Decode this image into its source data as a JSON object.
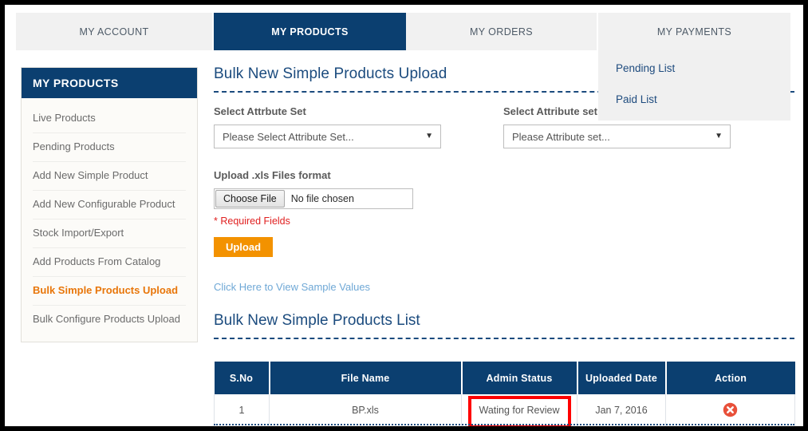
{
  "nav": {
    "tabs": [
      {
        "label": "MY ACCOUNT",
        "active": false
      },
      {
        "label": "MY PRODUCTS",
        "active": true
      },
      {
        "label": "MY ORDERS",
        "active": false
      },
      {
        "label": "MY PAYMENTS",
        "active": false
      }
    ],
    "dropdown": {
      "owner": "MY PAYMENTS",
      "items": [
        {
          "label": "Pending List"
        },
        {
          "label": "Paid List"
        }
      ]
    }
  },
  "sidebar": {
    "heading": "MY PRODUCTS",
    "items": [
      {
        "label": "Live Products",
        "selected": false
      },
      {
        "label": "Pending Products",
        "selected": false
      },
      {
        "label": "Add New Simple Product",
        "selected": false
      },
      {
        "label": "Add New Configurable Product",
        "selected": false
      },
      {
        "label": "Stock Import/Export",
        "selected": false
      },
      {
        "label": "Add Products From Catalog",
        "selected": false
      },
      {
        "label": "Bulk Simple Products Upload",
        "selected": true
      },
      {
        "label": "Bulk Configure Products Upload",
        "selected": false
      }
    ]
  },
  "main": {
    "page_title": "Bulk New Simple Products Upload",
    "attribute_set": {
      "label": "Select Attrbute Set",
      "value": "Please Select Attribute Set...",
      "caret": "chevron-down-icon"
    },
    "download_sample": {
      "label": "Select Attribute set For Download Sample CSV File",
      "value": "Please Attribute set...",
      "caret": "chevron-down-icon"
    },
    "upload": {
      "label": "Upload .xls Files format",
      "choose_button": "Choose File",
      "file_status": "No file chosen",
      "required_note": "* Required Fields",
      "submit_label": "Upload"
    },
    "sample_link": "Click Here to View Sample Values",
    "list_title": "Bulk New Simple Products List"
  },
  "table": {
    "columns": [
      "S.No",
      "File Name",
      "Admin Status",
      "Uploaded Date",
      "Action"
    ],
    "rows": [
      {
        "sno": "1",
        "file_name": "BP.xls",
        "admin_status": "Wating for Review",
        "uploaded_date": "Jan 7, 2016",
        "action_icon": "delete-circle-icon",
        "status_highlighted": true
      }
    ]
  },
  "colors": {
    "brand_navy": "#0b3f70",
    "accent_orange": "#f39200",
    "selected_item": "#e8760a",
    "required_red": "#e02020",
    "highlight_red": "#ff0000",
    "delete_icon": "#e8503a",
    "link_blue": "#6fa8d6"
  }
}
